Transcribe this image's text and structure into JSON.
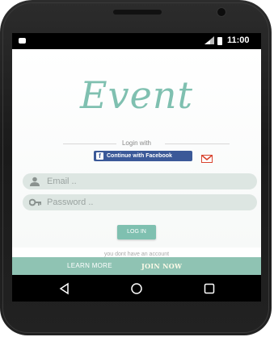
{
  "status_bar": {
    "time": "11:00"
  },
  "app": {
    "logo_text": "Event"
  },
  "login": {
    "login_with_label": "Login with",
    "facebook_button_label": "Continue with Facebook",
    "email_placeholder": "Email ..",
    "password_placeholder": "Password ..",
    "login_button_label": "LOG IN",
    "no_account_text": "you dont have an account",
    "learn_more_label": "LEARN MORE",
    "join_now_label": "JOIN NOW"
  },
  "icons": {
    "facebook": "facebook-icon",
    "gmail": "gmail-icon",
    "email": "person-icon",
    "password": "key-icon",
    "back": "back-icon",
    "home": "home-icon",
    "recents": "recents-icon"
  },
  "colors": {
    "accent": "#7fc0b0",
    "bottom_bar": "#8fc3b3",
    "input_bg": "#dde6e2",
    "facebook": "#3b5998",
    "gmail": "#d9442f"
  }
}
